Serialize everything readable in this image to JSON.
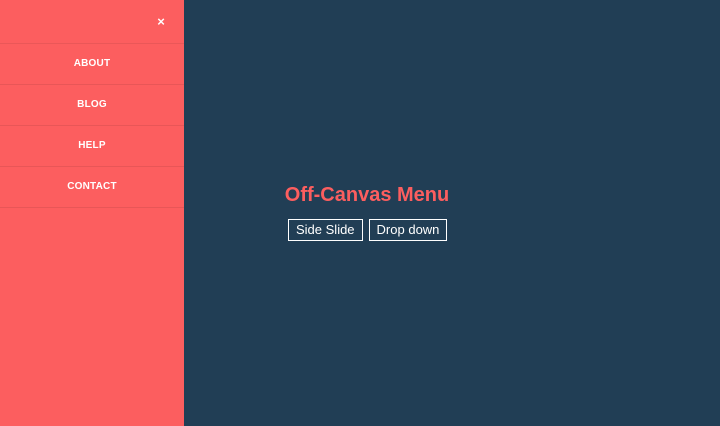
{
  "menu": {
    "close_label": "×",
    "items": [
      {
        "label": "ABOUT"
      },
      {
        "label": "BLOG"
      },
      {
        "label": "HELP"
      },
      {
        "label": "CONTACT"
      }
    ]
  },
  "main": {
    "title": "Off-Canvas Menu",
    "buttons": [
      {
        "label": "Side Slide"
      },
      {
        "label": "Drop down"
      }
    ]
  },
  "colors": {
    "menu_background": "#fc5e5f",
    "page_background": "#213e55",
    "title": "#fc5e5f",
    "button_text_border": "#ffffff"
  }
}
